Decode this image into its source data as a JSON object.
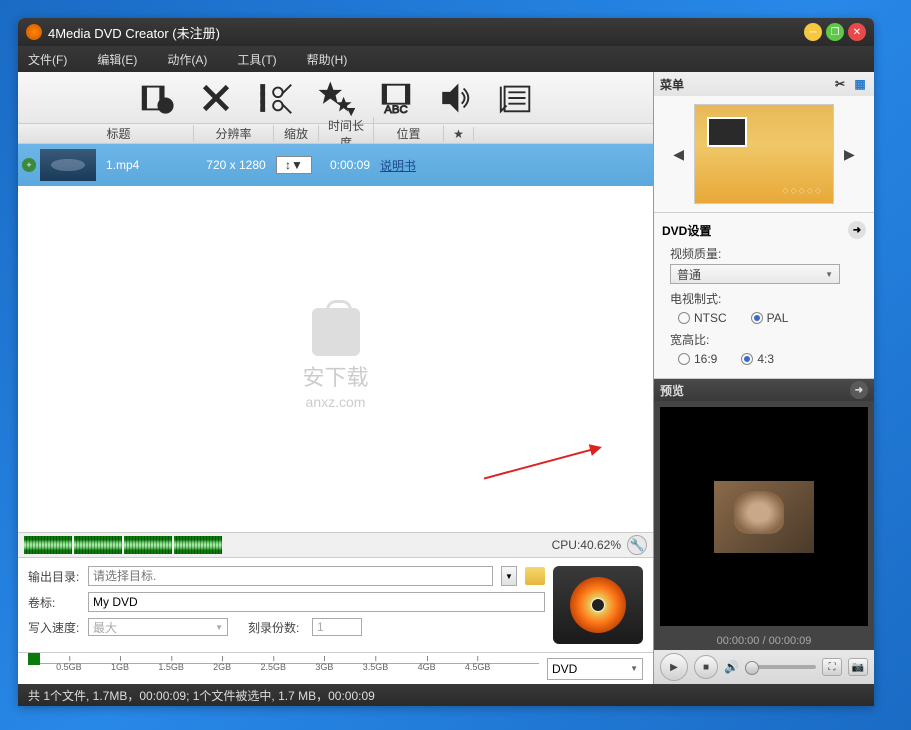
{
  "title": "4Media DVD Creator (未注册)",
  "menu": {
    "file": "文件(F)",
    "edit": "编辑(E)",
    "action": "动作(A)",
    "tool": "工具(T)",
    "help": "帮助(H)"
  },
  "listhead": {
    "title": "标题",
    "res": "分辨率",
    "zoom": "缩放",
    "dur": "时间长度",
    "pos": "位置",
    "star": "★"
  },
  "file": {
    "name": "1.mp4",
    "res": "720 x 1280",
    "zoom": "↕",
    "dur": "0:00:09",
    "link": "说明书"
  },
  "watermark": {
    "txt": "安下载",
    "sub": "anxz.com"
  },
  "cpu": {
    "label": "CPU:",
    "pct": "40.62%"
  },
  "out": {
    "dir_label": "输出目录:",
    "dir_ph": "请选择目标.",
    "vol_label": "卷标:",
    "vol_val": "My DVD",
    "spd_label": "写入速度:",
    "spd_val": "最大",
    "copies_label": "刻录份数:",
    "copies_val": "1"
  },
  "ruler": {
    "marks": [
      "0.5GB",
      "1GB",
      "1.5GB",
      "2GB",
      "2.5GB",
      "3GB",
      "3.5GB",
      "4GB",
      "4.5GB"
    ],
    "sel": "DVD"
  },
  "status": "共 1个文件, 1.7MB，00:00:09; 1个文件被选中, 1.7 MB，00:00:09",
  "rpanel": {
    "menu_title": "菜单",
    "dvd_title": "DVD设置",
    "vq_label": "视频质量:",
    "vq_val": "普通",
    "tv_label": "电视制式:",
    "tv_ntsc": "NTSC",
    "tv_pal": "PAL",
    "ar_label": "宽高比:",
    "ar_169": "16:9",
    "ar_43": "4:3",
    "prev_title": "预览",
    "time": "00:00:00 / 00:00:09"
  }
}
